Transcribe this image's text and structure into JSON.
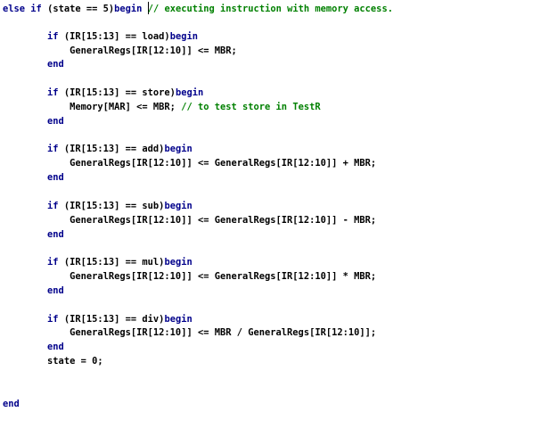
{
  "colors": {
    "keyword": "#00008b",
    "comment": "#008000",
    "text": "#000000",
    "background": "#ffffff"
  },
  "lines": [
    [
      {
        "t": "kw",
        "s": "else"
      },
      {
        "t": "ws",
        "s": " "
      },
      {
        "t": "kw",
        "s": "if"
      },
      {
        "t": "ws",
        "s": " "
      },
      {
        "t": "op",
        "s": "(state == 5)"
      },
      {
        "t": "kw",
        "s": "begin"
      },
      {
        "t": "ws",
        "s": " "
      },
      {
        "t": "caret",
        "s": ""
      },
      {
        "t": "cm",
        "s": "// executing instruction with memory access."
      }
    ],
    [],
    [
      {
        "t": "ws",
        "s": "        "
      },
      {
        "t": "kw",
        "s": "if"
      },
      {
        "t": "ws",
        "s": " "
      },
      {
        "t": "op",
        "s": "(IR[15:13] == load)"
      },
      {
        "t": "kw",
        "s": "begin"
      }
    ],
    [
      {
        "t": "ws",
        "s": "            "
      },
      {
        "t": "id",
        "s": "GeneralRegs[IR[12:10]] <= MBR;"
      }
    ],
    [
      {
        "t": "ws",
        "s": "        "
      },
      {
        "t": "kw",
        "s": "end"
      }
    ],
    [],
    [
      {
        "t": "ws",
        "s": "        "
      },
      {
        "t": "kw",
        "s": "if"
      },
      {
        "t": "ws",
        "s": " "
      },
      {
        "t": "op",
        "s": "(IR[15:13] == store)"
      },
      {
        "t": "kw",
        "s": "begin"
      }
    ],
    [
      {
        "t": "ws",
        "s": "            "
      },
      {
        "t": "id",
        "s": "Memory[MAR] <= MBR; "
      },
      {
        "t": "cm",
        "s": "// to test store in TestR"
      }
    ],
    [
      {
        "t": "ws",
        "s": "        "
      },
      {
        "t": "kw",
        "s": "end"
      }
    ],
    [],
    [
      {
        "t": "ws",
        "s": "        "
      },
      {
        "t": "kw",
        "s": "if"
      },
      {
        "t": "ws",
        "s": " "
      },
      {
        "t": "op",
        "s": "(IR[15:13] == add)"
      },
      {
        "t": "kw",
        "s": "begin"
      }
    ],
    [
      {
        "t": "ws",
        "s": "            "
      },
      {
        "t": "id",
        "s": "GeneralRegs[IR[12:10]] <= GeneralRegs[IR[12:10]] + MBR;"
      }
    ],
    [
      {
        "t": "ws",
        "s": "        "
      },
      {
        "t": "kw",
        "s": "end"
      }
    ],
    [],
    [
      {
        "t": "ws",
        "s": "        "
      },
      {
        "t": "kw",
        "s": "if"
      },
      {
        "t": "ws",
        "s": " "
      },
      {
        "t": "op",
        "s": "(IR[15:13] == sub)"
      },
      {
        "t": "kw",
        "s": "begin"
      }
    ],
    [
      {
        "t": "ws",
        "s": "            "
      },
      {
        "t": "id",
        "s": "GeneralRegs[IR[12:10]] <= GeneralRegs[IR[12:10]] - MBR;"
      }
    ],
    [
      {
        "t": "ws",
        "s": "        "
      },
      {
        "t": "kw",
        "s": "end"
      }
    ],
    [],
    [
      {
        "t": "ws",
        "s": "        "
      },
      {
        "t": "kw",
        "s": "if"
      },
      {
        "t": "ws",
        "s": " "
      },
      {
        "t": "op",
        "s": "(IR[15:13] == mul)"
      },
      {
        "t": "kw",
        "s": "begin"
      }
    ],
    [
      {
        "t": "ws",
        "s": "            "
      },
      {
        "t": "id",
        "s": "GeneralRegs[IR[12:10]] <= GeneralRegs[IR[12:10]] * MBR;"
      }
    ],
    [
      {
        "t": "ws",
        "s": "        "
      },
      {
        "t": "kw",
        "s": "end"
      }
    ],
    [],
    [
      {
        "t": "ws",
        "s": "        "
      },
      {
        "t": "kw",
        "s": "if"
      },
      {
        "t": "ws",
        "s": " "
      },
      {
        "t": "op",
        "s": "(IR[15:13] == div)"
      },
      {
        "t": "kw",
        "s": "begin"
      }
    ],
    [
      {
        "t": "ws",
        "s": "            "
      },
      {
        "t": "id",
        "s": "GeneralRegs[IR[12:10]] <= MBR / GeneralRegs[IR[12:10]];"
      }
    ],
    [
      {
        "t": "ws",
        "s": "        "
      },
      {
        "t": "kw",
        "s": "end"
      }
    ],
    [
      {
        "t": "ws",
        "s": "        "
      },
      {
        "t": "id",
        "s": "state = 0;"
      }
    ],
    [],
    [],
    [
      {
        "t": "kw",
        "s": "end"
      }
    ]
  ]
}
